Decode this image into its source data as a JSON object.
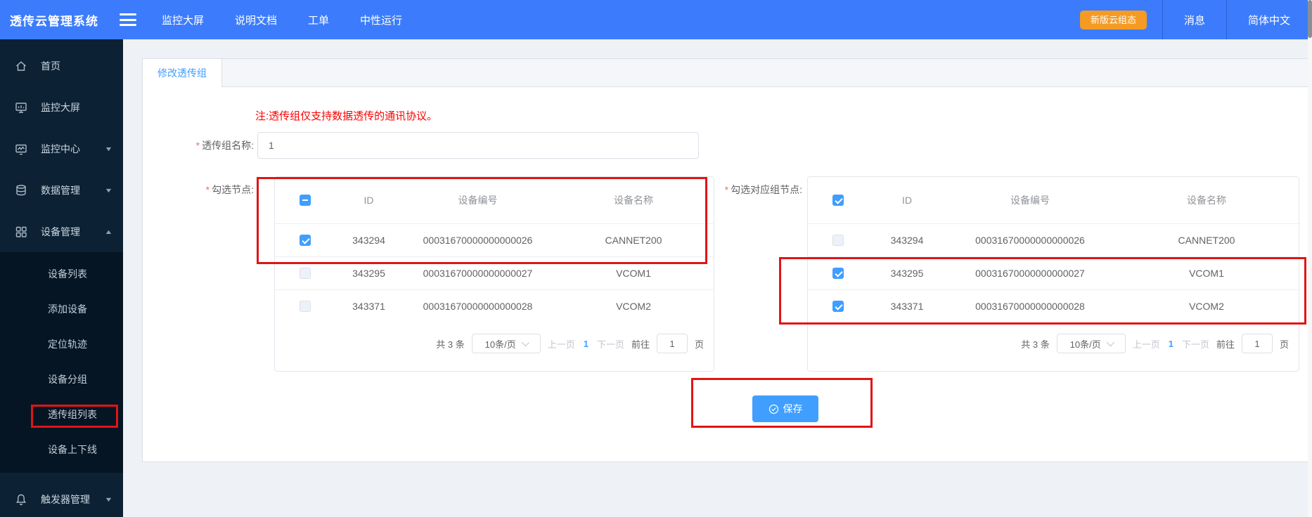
{
  "topbar": {
    "brand": "透传云管理系统",
    "nav": {
      "item1": "监控大屏",
      "item2": "说明文档",
      "item3": "工单",
      "item4": "中性运行"
    },
    "new_version_button": "新版云组态",
    "message": "消息",
    "language": "简体中文"
  },
  "sidebar": {
    "home": "首页",
    "monitor_screen": "监控大屏",
    "monitor_center": "监控中心",
    "data_manage": "数据管理",
    "device_manage": "设备管理",
    "submenu": {
      "device_list": "设备列表",
      "add_device": "添加设备",
      "locate_track": "定位轨迹",
      "device_group": "设备分组",
      "passthrough_group_list": "透传组列表",
      "device_online_offline": "设备上下线"
    },
    "trigger_manage": "触发器管理"
  },
  "main": {
    "tab": "修改透传组",
    "note": "注:透传组仅支持数据透传的通讯协议。",
    "required_mark": "*",
    "name_field": {
      "label": "透传组名称:",
      "value": "1"
    },
    "columns": {
      "id": "ID",
      "code": "设备编号",
      "name": "设备名称"
    },
    "left_panel": {
      "label": "勾选节点:",
      "header_checkbox": "indeterminate",
      "rows": [
        {
          "checked": "checked",
          "id": "343294",
          "code": "00031670000000000026",
          "name": "CANNET200"
        },
        {
          "checked": "unchecked",
          "id": "343295",
          "code": "00031670000000000027",
          "name": "VCOM1"
        },
        {
          "checked": "unchecked",
          "id": "343371",
          "code": "00031670000000000028",
          "name": "VCOM2"
        }
      ]
    },
    "right_panel": {
      "label": "勾选对应组节点:",
      "header_checkbox": "checked",
      "rows": [
        {
          "checked": "unchecked",
          "id": "343294",
          "code": "00031670000000000026",
          "name": "CANNET200"
        },
        {
          "checked": "checked",
          "id": "343295",
          "code": "00031670000000000027",
          "name": "VCOM1"
        },
        {
          "checked": "checked",
          "id": "343371",
          "code": "00031670000000000028",
          "name": "VCOM2"
        }
      ]
    },
    "pagination": {
      "total": "共 3 条",
      "page_size": "10条/页",
      "prev": "上一页",
      "page": "1",
      "next": "下一页",
      "goto": "前往",
      "goto_value": "1",
      "unit": "页"
    },
    "save_button": "保存"
  },
  "colors": {
    "topbar_blue": "#3c7cfc",
    "accent_blue": "#409eff",
    "orange": "#f59a23",
    "sidebar_dark": "#0c2234",
    "annotation_red": "#e01515",
    "note_red": "#fe0000"
  }
}
